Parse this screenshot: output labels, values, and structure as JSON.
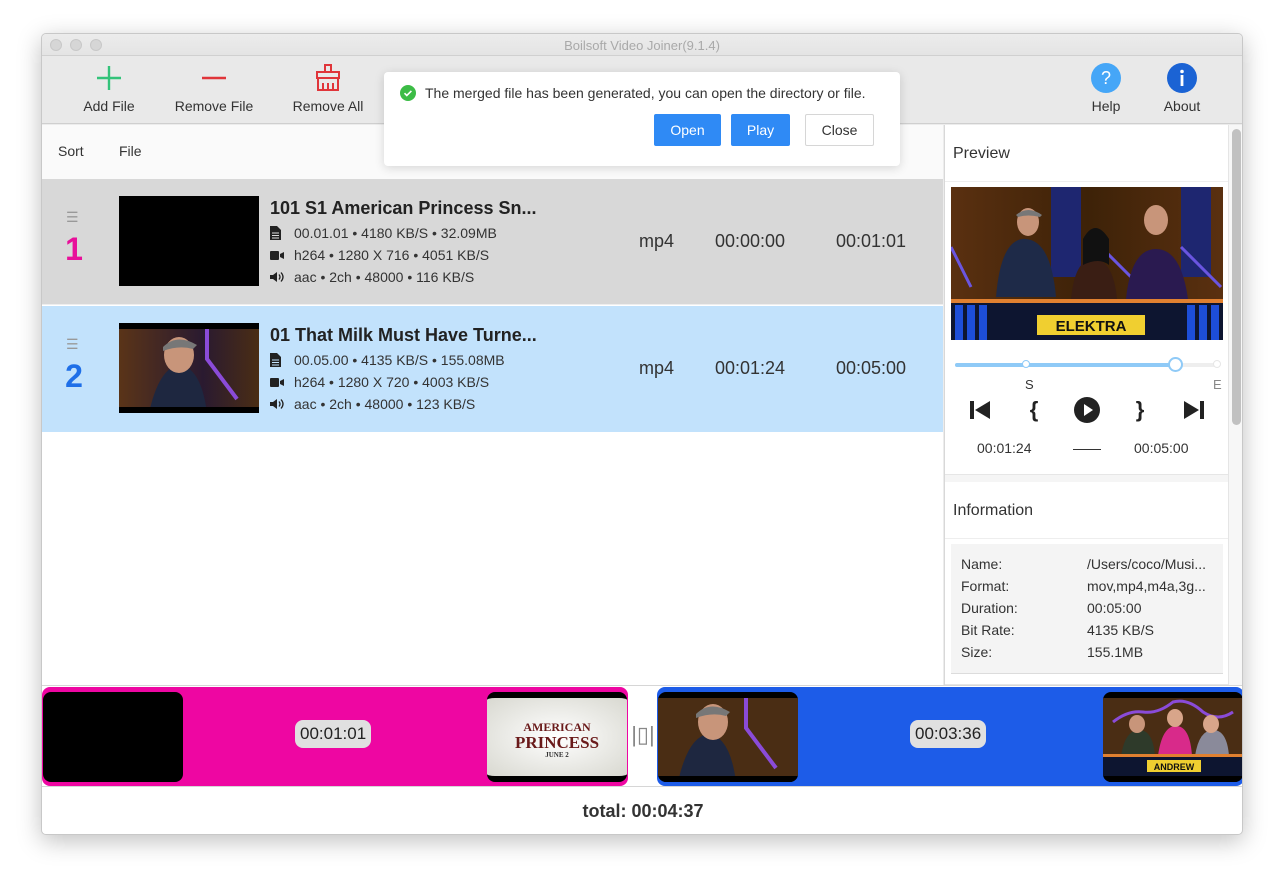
{
  "window": {
    "title": "Boilsoft Video Joiner(9.1.4)"
  },
  "toolbar": {
    "add_file": "Add File",
    "remove_file": "Remove File",
    "remove_all": "Remove All",
    "help": "Help",
    "about": "About"
  },
  "toast": {
    "message": "The merged file has been generated, you can open the directory or file.",
    "open": "Open",
    "play": "Play",
    "close": "Close"
  },
  "list": {
    "headers": {
      "sort": "Sort",
      "file": "File"
    },
    "rows": [
      {
        "index": "1",
        "name": "101 S1 American Princess Sn...",
        "file_info": "00.01.01 •  4180 KB/S • 32.09MB",
        "video_info": "h264 • 1280 X 716 • 4051 KB/S",
        "audio_info": "aac • 2ch • 48000 • 116 KB/S",
        "format": "mp4",
        "start": "00:00:00",
        "end": "00:01:01",
        "index_color": "#e8109a",
        "thumbnail": "black"
      },
      {
        "index": "2",
        "name": "01 That Milk Must Have Turne...",
        "file_info": "00.05.00 •  4135 KB/S • 155.08MB",
        "video_info": "h264 • 1280 X 720 • 4003 KB/S",
        "audio_info": "aac • 2ch • 48000 • 123 KB/S",
        "format": "mp4",
        "start": "00:01:24",
        "end": "00:05:00",
        "index_color": "#1e6fe8",
        "thumbnail": "man-in-cap-on-stage"
      }
    ]
  },
  "preview": {
    "title": "Preview",
    "image_caption": "ELEKTRA",
    "start_marker": "S",
    "end_marker": "E",
    "current_time": "00:01:24",
    "separator": "——",
    "end_time": "00:05:00",
    "progress_fraction": 0.835,
    "start_fraction": 0.27
  },
  "information": {
    "title": "Information",
    "fields": [
      {
        "key": "Name:",
        "value": "/Users/coco/Musi..."
      },
      {
        "key": "Format:",
        "value": "mov,mp4,m4a,3g..."
      },
      {
        "key": "Duration:",
        "value": "00:05:00"
      },
      {
        "key": "Bit Rate:",
        "value": "4135 KB/S"
      },
      {
        "key": "Size:",
        "value": "155.1MB"
      }
    ]
  },
  "timeline": {
    "segments": [
      {
        "duration": "00:01:01",
        "color": "#ee06a2",
        "end_thumb_title": "AMERICAN",
        "end_thumb_title2": "PRINCESS",
        "end_thumb_sub": "JUNE 2"
      },
      {
        "duration": "00:03:36",
        "color": "#1d5ce8",
        "end_thumb_caption": "ANDREW"
      }
    ],
    "total": "total: 00:04:37"
  },
  "colors": {
    "accent": "#2f8af5",
    "row_selected": "#c2e2fc",
    "row_default": "#d8d8d8",
    "success": "#3cbc46"
  }
}
